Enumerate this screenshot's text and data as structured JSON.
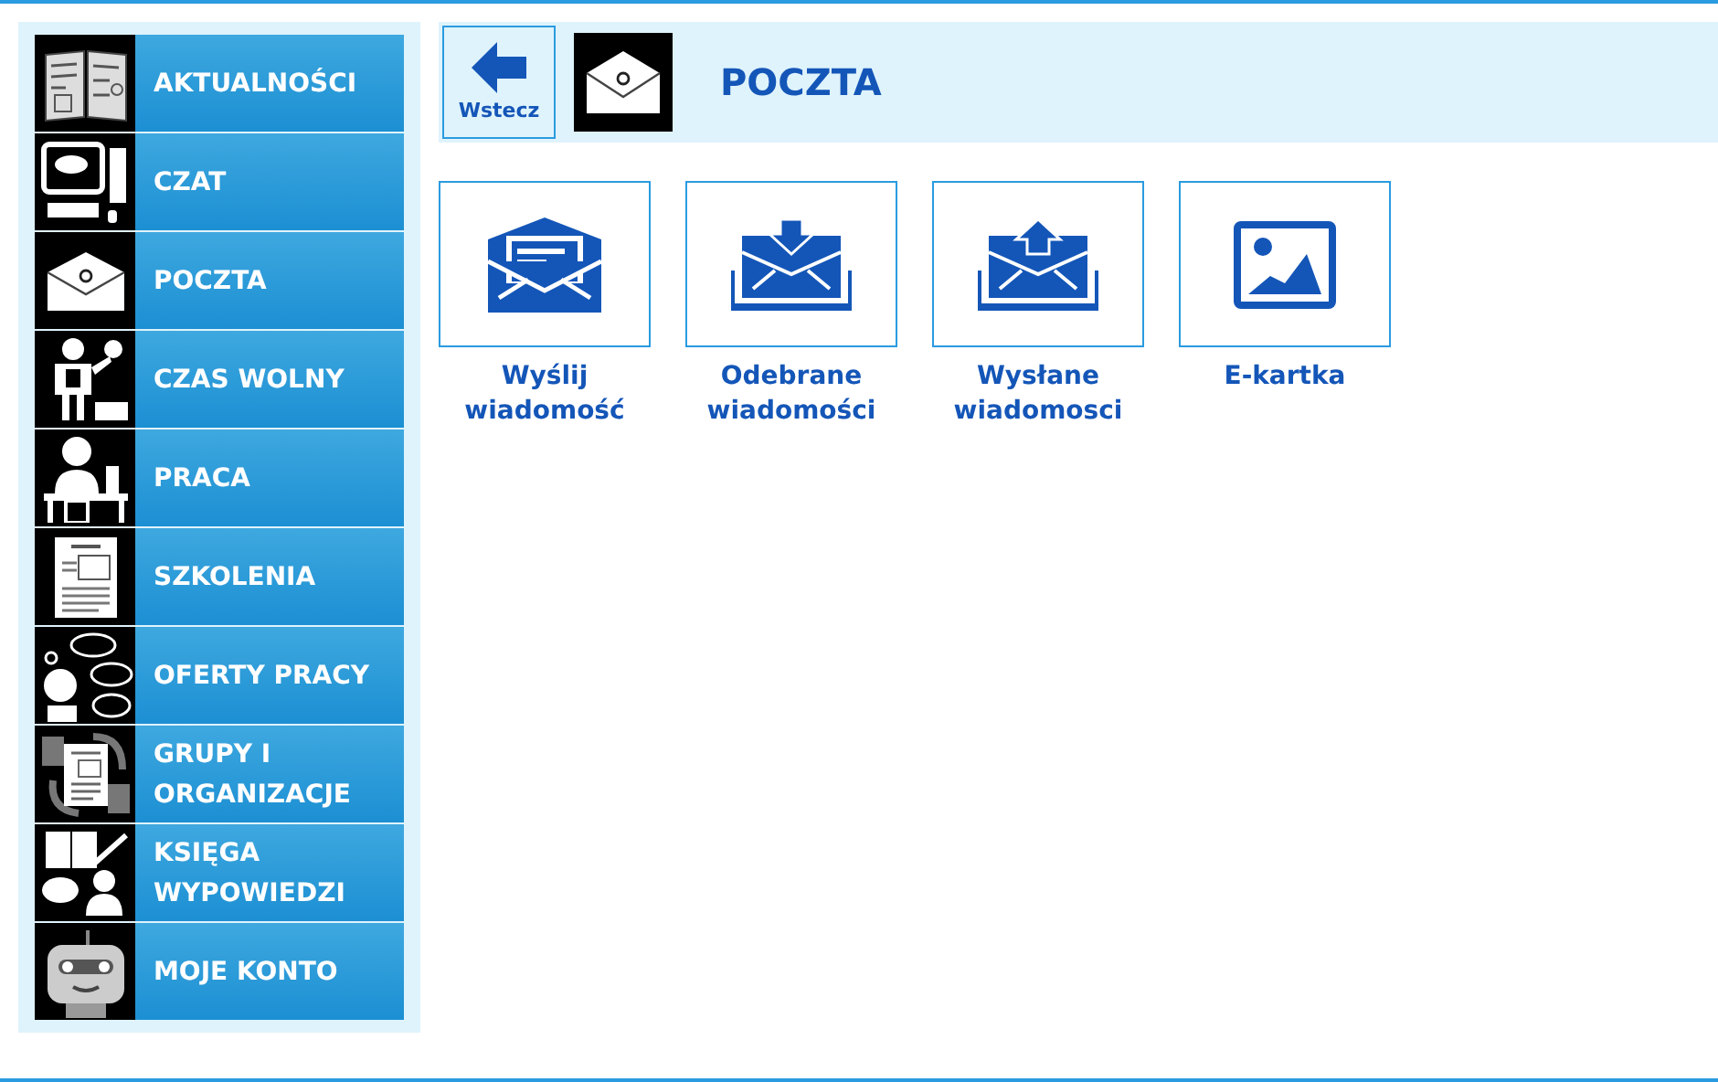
{
  "sidebar": {
    "items": [
      {
        "label": "AKTUALNOŚCI"
      },
      {
        "label": "CZAT"
      },
      {
        "label": "POCZTA"
      },
      {
        "label": "CZAS WOLNY"
      },
      {
        "label": "PRACA"
      },
      {
        "label": "SZKOLENIA"
      },
      {
        "label": "OFERTY PRACY"
      },
      {
        "label": "GRUPY I ORGANIZACJE"
      },
      {
        "label": "KSIĘGA WYPOWIEDZI"
      },
      {
        "label": "MOJE KONTO"
      }
    ]
  },
  "header": {
    "back_button": "Wstecz",
    "title": "POCZTA"
  },
  "tiles": [
    {
      "label": "Wyślij wiadomość"
    },
    {
      "label": "Odebrane wiadomości"
    },
    {
      "label": "Wysłane wiadomosci"
    },
    {
      "label": "E-kartka"
    }
  ]
}
